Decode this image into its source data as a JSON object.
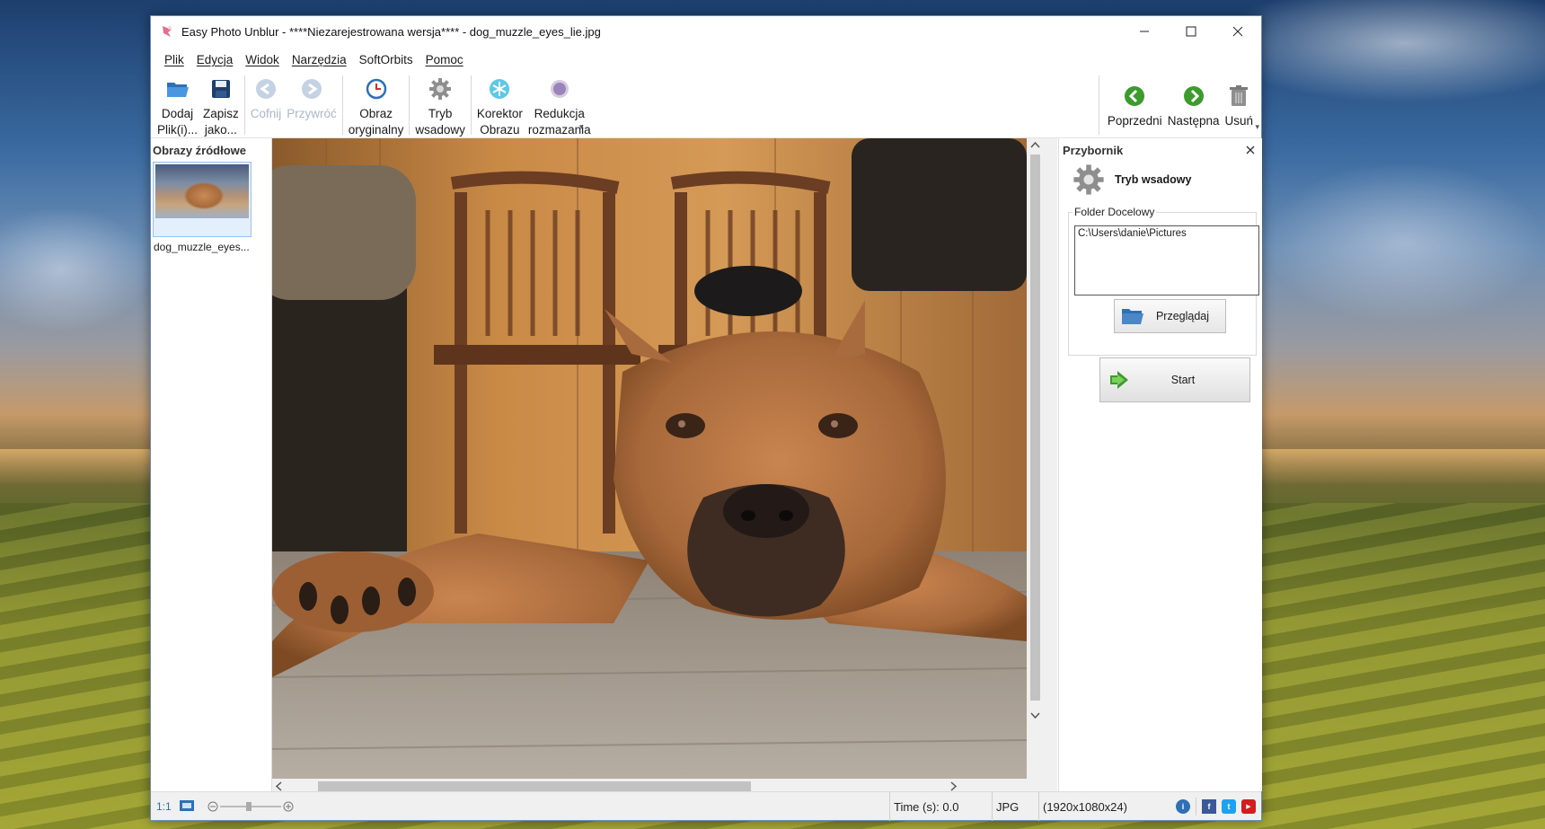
{
  "window": {
    "title": "Easy Photo Unblur - ****Niezarejestrowana wersja**** - dog_muzzle_eyes_lie.jpg"
  },
  "menu": [
    "Plik",
    "Edycja",
    "Widok",
    "Narzędzia",
    "SoftOrbits",
    "Pomoc"
  ],
  "toolbar": {
    "add": {
      "line1": "Dodaj",
      "line2": "Plik(i)..."
    },
    "save": {
      "line1": "Zapisz",
      "line2": "jako..."
    },
    "undo": "Cofnij",
    "redo": "Przywróć",
    "original": {
      "line1": "Obraz",
      "line2": "oryginalny"
    },
    "batch": {
      "line1": "Tryb",
      "line2": "wsadowy"
    },
    "corrector": {
      "line1": "Korektor",
      "line2": "Obrazu"
    },
    "deblur": {
      "line1": "Redukcja",
      "line2": "rozmazania"
    },
    "prev": "Poprzedni",
    "next": "Następna",
    "delete": "Usuń"
  },
  "sources": {
    "title": "Obrazy źródłowe",
    "items": [
      {
        "label": "dog_muzzle_eyes..."
      }
    ]
  },
  "toolbox": {
    "title": "Przybornik",
    "mode": "Tryb wsadowy",
    "folder_label": "Folder Docelowy",
    "folder_value": "C:\\Users\\danie\\Pictures",
    "browse": "Przeglądaj",
    "start": "Start"
  },
  "statusbar": {
    "zoom_ratio": "1:1",
    "time": "Time (s): 0.0",
    "format": "JPG",
    "dimensions": "(1920x1080x24)"
  },
  "colors": {
    "accent_green": "#3c9b2c",
    "folder_blue": "#4a86c8",
    "youtube_red": "#d11e1e",
    "facebook_blue": "#3b5998",
    "twitter_blue": "#1da1f2"
  }
}
